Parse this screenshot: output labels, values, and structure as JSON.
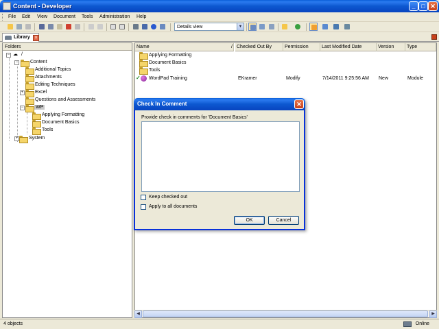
{
  "window": {
    "title": "Content - Developer",
    "minimize": "_",
    "maximize": "□",
    "close": "✕"
  },
  "menu": [
    "File",
    "Edit",
    "View",
    "Document",
    "Tools",
    "Administration",
    "Help"
  ],
  "toolbar": {
    "view_select": "Details view"
  },
  "tab": {
    "label": "Library"
  },
  "folders": {
    "header": "Folders",
    "root": "/",
    "content": "Content",
    "children": [
      "Additional Topics",
      "Attachments",
      "Editing Techniques",
      "Excel",
      "Questions and Assessments",
      "WP"
    ],
    "wp_children": [
      "Applying Formatting",
      "Document Basics",
      "Tools"
    ],
    "system": "System"
  },
  "documents": {
    "columns": [
      "Name",
      "/",
      "Checked Out By",
      "Permission",
      "Last Modified Date",
      "Version",
      "Type"
    ],
    "rows": [
      {
        "name": "Applying Formatting"
      },
      {
        "name": "Document Basics"
      },
      {
        "name": "Tools"
      },
      {
        "name": "WordPad Training",
        "checked_out_by": "EKramer",
        "permission": "Modify",
        "modified": "7/14/2011 9:25:56 AM",
        "version": "New",
        "type": "Module"
      }
    ]
  },
  "dialog": {
    "title": "Check In Comment",
    "prompt": "Provide check in comments for 'Document Basics'",
    "keep_checked_out": "Keep checked out",
    "apply_all": "Apply to all documents",
    "ok": "OK",
    "cancel": "Cancel"
  },
  "status": {
    "count": "4 objects",
    "online": "Online"
  }
}
